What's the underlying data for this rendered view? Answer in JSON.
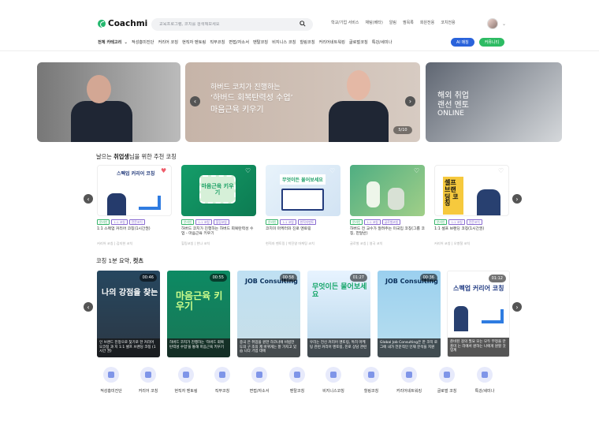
{
  "header": {
    "logo": "Coachmi",
    "search": {
      "placeholder": "교육프로그램, 코치를 검색해보세요"
    },
    "links": [
      "학교/기업 서비스",
      "채팅(베타)",
      "알림",
      "찜목록",
      "회원전용",
      "코치전용"
    ]
  },
  "nav": {
    "all_category": "전체 카테고리",
    "items": [
      "적성흥미진단",
      "커리어 코칭",
      "현직자 멘토링",
      "직무코칭",
      "면접/자소서",
      "멘탈코칭",
      "비지니스 코칭",
      "힐링코칭",
      "커리어네트워킹",
      "글로벌코칭",
      "특강/세미나"
    ],
    "ai_button": "AI 매칭",
    "community_button": "커뮤니티"
  },
  "hero": {
    "center_line1": "하버드 코치가 진행하는",
    "center_line2": "‘하버드 회복탄력성 수업’",
    "center_line3": "마음근육 키우기",
    "counter": "5/10",
    "right_line1": "해외 취업",
    "right_line2": "랜선 멘토",
    "right_line3": "ONLINE"
  },
  "recommend": {
    "title_prefix": "날으는 ",
    "title_bold": "취업생",
    "title_suffix": "님을 위한 추천 코칭",
    "cards": [
      {
        "thumb_text": "스펙업 커리어 코칭",
        "tags": [
          "온라인",
          "1:1 코칭",
          "전문코치"
        ],
        "title": "1:1 스펙업 커리어 코칭(1시간권)",
        "meta": "커리어 코칭 | 김지현 코치"
      },
      {
        "thumb_text": "마음근육 키우기",
        "tags": [
          "온라인",
          "1:1 코칭",
          "힐링코칭"
        ],
        "title": "하버드 코치가 진행하는 하버드 회복탄력성 수업 - 마음근육 키우기",
        "meta": "힐링코칭 | 한나 코치"
      },
      {
        "thumb_text": "무엇이든 물어보세요",
        "tags": [
          "온라인",
          "1:1 코칭",
          "현직자멘토"
        ],
        "title": "코치미 마케터와 진로 멘토링",
        "meta": "현직자 멘토링 | 박진영 마케팅 코치"
      },
      {
        "thumb_text": "",
        "tags": [
          "온라인",
          "1:1 코칭",
          "글로벌코칭"
        ],
        "title": "하버드 전 교수가 알려주는 미국입 코칭(그룹 코칭, 한달반)",
        "meta": "글로벌 코칭 | 영국 코치"
      },
      {
        "thumb_text": "셀프 브랜딩 코칭",
        "tags": [
          "온라인",
          "1:1 코칭",
          "전문코치"
        ],
        "title": "1:1 셀프 브랜딩 코칭(1시간권)",
        "meta": "커리어 코칭 | 오병철 코치"
      }
    ]
  },
  "shorts": {
    "title_prefix": "코칭 1분 요약, ",
    "title_bold": "컷츠",
    "items": [
      {
        "time": "00:46",
        "headline": "나의 강점을 찾는",
        "caption": "인 브랜드 진정으로 찾기로 한 커리어 오코칭 과 지 1:1 셀프 브랜딩 코칭 (1시간 권)"
      },
      {
        "time": "00:55",
        "headline": "마음근육 키우기",
        "caption": "하버드 코치가 진행하는 '하버드 회복 탄력성 수업'을 통해 마음근육 키우기"
      },
      {
        "time": "00:58",
        "headline": "JOB Consulting",
        "caption": "중국 은 취업을 원한 하코너에 비범한 도의 구 조의 제 바뀌게는 잘 가지고 있습 니다 기업 데에"
      },
      {
        "time": "01:27",
        "headline": "무엇이든 물어보세요",
        "caption": "우리는 전신 커리어 멘토링, 특히 마케팅 관련 커리어 멘토링, 진로 상담 관련"
      },
      {
        "time": "00:36",
        "headline": "JOB Consulting",
        "caption": "Global Job Consulting은 한 코치 로 그에 내가 전문적인 인재 분석을 지원"
      },
      {
        "time": "01:12",
        "headline": "스펙업 커리어 코칭",
        "caption": "준비된 걸의 필요 모는 모두 부정을 만 흥미 는 리에서 원하는 나에게 원할 것 업계"
      }
    ]
  },
  "categories": [
    "적성흥미진단",
    "커리어 코칭",
    "현직자 멘토링",
    "직무코칭",
    "면접/자소서",
    "멘탈코칭",
    "비지니스코칭",
    "힐링코칭",
    "커리어네트워킹",
    "글로벌 코칭",
    "특강/세미나"
  ]
}
